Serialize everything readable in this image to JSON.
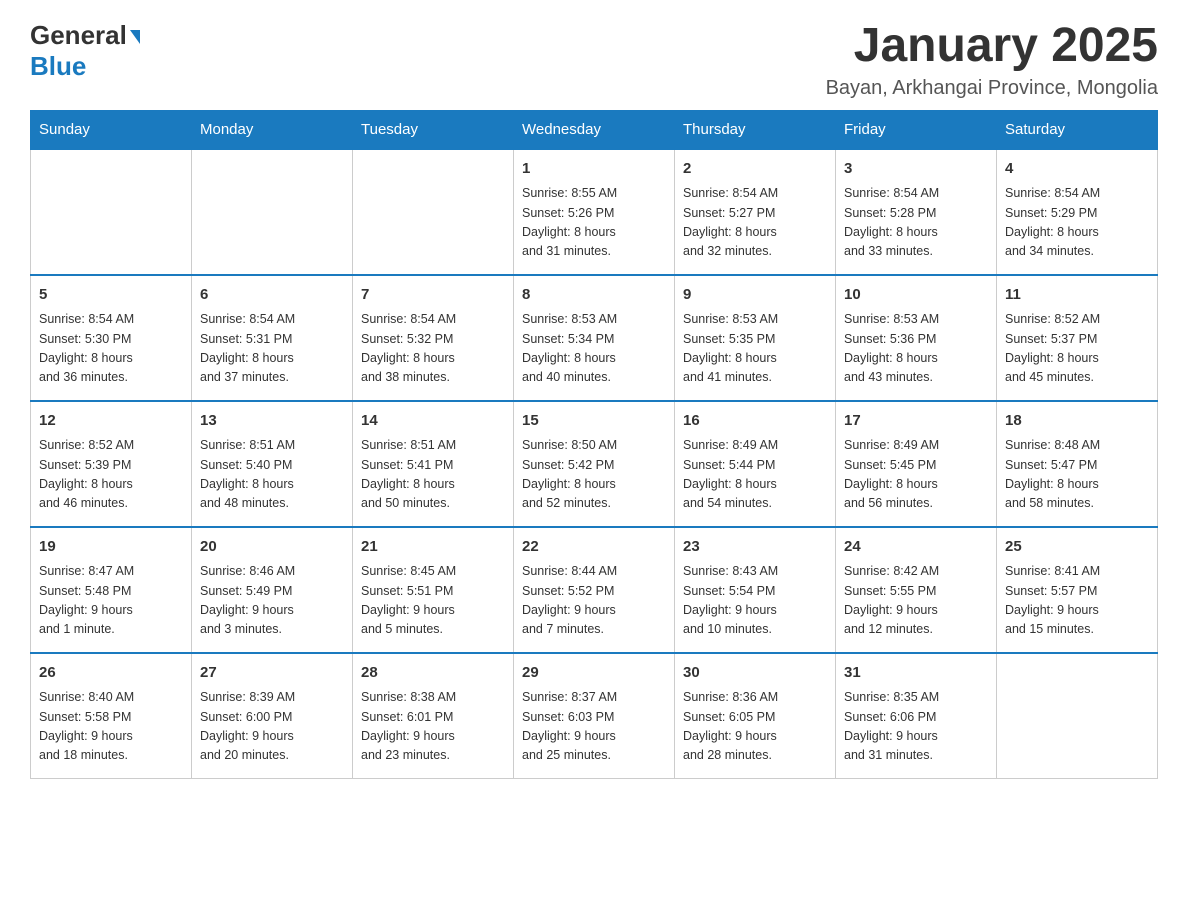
{
  "logo": {
    "line1": "General",
    "line2": "Blue"
  },
  "title": "January 2025",
  "location": "Bayan, Arkhangai Province, Mongolia",
  "days_of_week": [
    "Sunday",
    "Monday",
    "Tuesday",
    "Wednesday",
    "Thursday",
    "Friday",
    "Saturday"
  ],
  "weeks": [
    [
      {
        "day": "",
        "info": ""
      },
      {
        "day": "",
        "info": ""
      },
      {
        "day": "",
        "info": ""
      },
      {
        "day": "1",
        "info": "Sunrise: 8:55 AM\nSunset: 5:26 PM\nDaylight: 8 hours\nand 31 minutes."
      },
      {
        "day": "2",
        "info": "Sunrise: 8:54 AM\nSunset: 5:27 PM\nDaylight: 8 hours\nand 32 minutes."
      },
      {
        "day": "3",
        "info": "Sunrise: 8:54 AM\nSunset: 5:28 PM\nDaylight: 8 hours\nand 33 minutes."
      },
      {
        "day": "4",
        "info": "Sunrise: 8:54 AM\nSunset: 5:29 PM\nDaylight: 8 hours\nand 34 minutes."
      }
    ],
    [
      {
        "day": "5",
        "info": "Sunrise: 8:54 AM\nSunset: 5:30 PM\nDaylight: 8 hours\nand 36 minutes."
      },
      {
        "day": "6",
        "info": "Sunrise: 8:54 AM\nSunset: 5:31 PM\nDaylight: 8 hours\nand 37 minutes."
      },
      {
        "day": "7",
        "info": "Sunrise: 8:54 AM\nSunset: 5:32 PM\nDaylight: 8 hours\nand 38 minutes."
      },
      {
        "day": "8",
        "info": "Sunrise: 8:53 AM\nSunset: 5:34 PM\nDaylight: 8 hours\nand 40 minutes."
      },
      {
        "day": "9",
        "info": "Sunrise: 8:53 AM\nSunset: 5:35 PM\nDaylight: 8 hours\nand 41 minutes."
      },
      {
        "day": "10",
        "info": "Sunrise: 8:53 AM\nSunset: 5:36 PM\nDaylight: 8 hours\nand 43 minutes."
      },
      {
        "day": "11",
        "info": "Sunrise: 8:52 AM\nSunset: 5:37 PM\nDaylight: 8 hours\nand 45 minutes."
      }
    ],
    [
      {
        "day": "12",
        "info": "Sunrise: 8:52 AM\nSunset: 5:39 PM\nDaylight: 8 hours\nand 46 minutes."
      },
      {
        "day": "13",
        "info": "Sunrise: 8:51 AM\nSunset: 5:40 PM\nDaylight: 8 hours\nand 48 minutes."
      },
      {
        "day": "14",
        "info": "Sunrise: 8:51 AM\nSunset: 5:41 PM\nDaylight: 8 hours\nand 50 minutes."
      },
      {
        "day": "15",
        "info": "Sunrise: 8:50 AM\nSunset: 5:42 PM\nDaylight: 8 hours\nand 52 minutes."
      },
      {
        "day": "16",
        "info": "Sunrise: 8:49 AM\nSunset: 5:44 PM\nDaylight: 8 hours\nand 54 minutes."
      },
      {
        "day": "17",
        "info": "Sunrise: 8:49 AM\nSunset: 5:45 PM\nDaylight: 8 hours\nand 56 minutes."
      },
      {
        "day": "18",
        "info": "Sunrise: 8:48 AM\nSunset: 5:47 PM\nDaylight: 8 hours\nand 58 minutes."
      }
    ],
    [
      {
        "day": "19",
        "info": "Sunrise: 8:47 AM\nSunset: 5:48 PM\nDaylight: 9 hours\nand 1 minute."
      },
      {
        "day": "20",
        "info": "Sunrise: 8:46 AM\nSunset: 5:49 PM\nDaylight: 9 hours\nand 3 minutes."
      },
      {
        "day": "21",
        "info": "Sunrise: 8:45 AM\nSunset: 5:51 PM\nDaylight: 9 hours\nand 5 minutes."
      },
      {
        "day": "22",
        "info": "Sunrise: 8:44 AM\nSunset: 5:52 PM\nDaylight: 9 hours\nand 7 minutes."
      },
      {
        "day": "23",
        "info": "Sunrise: 8:43 AM\nSunset: 5:54 PM\nDaylight: 9 hours\nand 10 minutes."
      },
      {
        "day": "24",
        "info": "Sunrise: 8:42 AM\nSunset: 5:55 PM\nDaylight: 9 hours\nand 12 minutes."
      },
      {
        "day": "25",
        "info": "Sunrise: 8:41 AM\nSunset: 5:57 PM\nDaylight: 9 hours\nand 15 minutes."
      }
    ],
    [
      {
        "day": "26",
        "info": "Sunrise: 8:40 AM\nSunset: 5:58 PM\nDaylight: 9 hours\nand 18 minutes."
      },
      {
        "day": "27",
        "info": "Sunrise: 8:39 AM\nSunset: 6:00 PM\nDaylight: 9 hours\nand 20 minutes."
      },
      {
        "day": "28",
        "info": "Sunrise: 8:38 AM\nSunset: 6:01 PM\nDaylight: 9 hours\nand 23 minutes."
      },
      {
        "day": "29",
        "info": "Sunrise: 8:37 AM\nSunset: 6:03 PM\nDaylight: 9 hours\nand 25 minutes."
      },
      {
        "day": "30",
        "info": "Sunrise: 8:36 AM\nSunset: 6:05 PM\nDaylight: 9 hours\nand 28 minutes."
      },
      {
        "day": "31",
        "info": "Sunrise: 8:35 AM\nSunset: 6:06 PM\nDaylight: 9 hours\nand 31 minutes."
      },
      {
        "day": "",
        "info": ""
      }
    ]
  ]
}
